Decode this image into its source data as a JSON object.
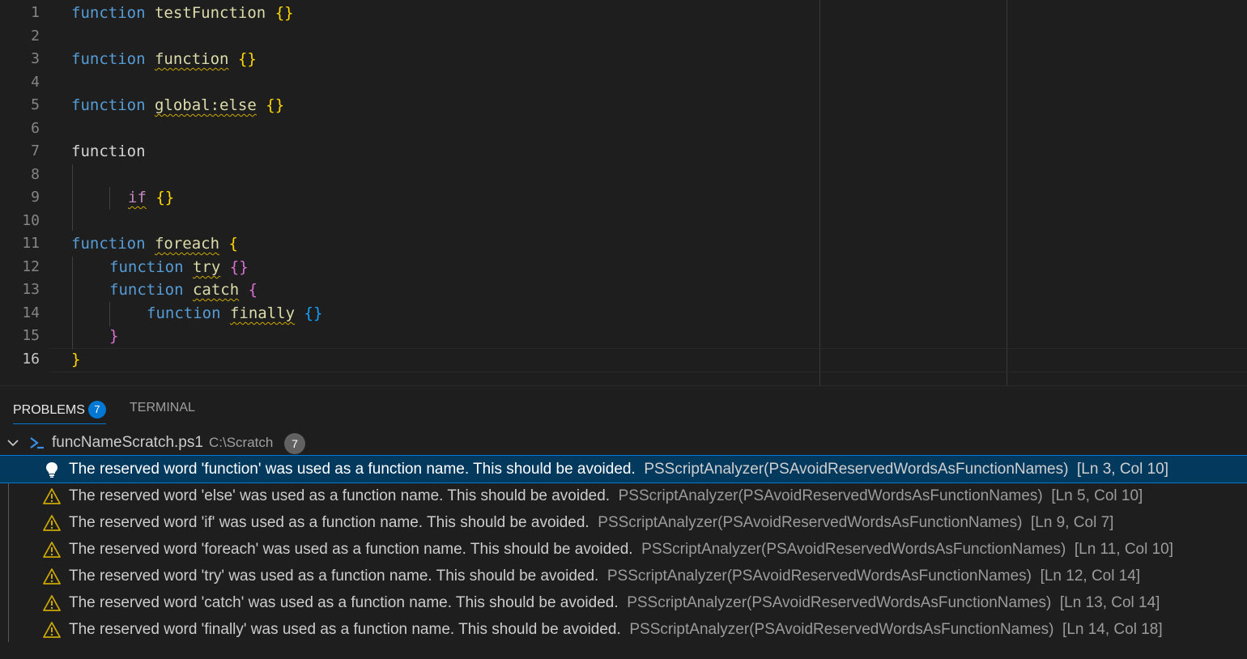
{
  "editor": {
    "line_numbers": [
      "1",
      "2",
      "3",
      "4",
      "5",
      "6",
      "7",
      "8",
      "9",
      "10",
      "11",
      "12",
      "13",
      "14",
      "15",
      "16"
    ],
    "active_line": "16",
    "tokens": {
      "function_kw": "function",
      "test_name": "testFunction",
      "function_name": "function",
      "global_name": "global:else",
      "if_name": "if",
      "foreach_name": "foreach",
      "try_name": "try",
      "catch_name": "catch",
      "finally_name": "finally",
      "empty_braces": "{}",
      "open_brace": "{",
      "close_brace": "}"
    }
  },
  "panel": {
    "tabs": {
      "problems": "PROBLEMS",
      "problems_count": "7",
      "terminal": "TERMINAL"
    },
    "file": {
      "name": "funcNameScratch.ps1",
      "path": "C:\\Scratch",
      "count": "7"
    },
    "problems": [
      {
        "message": "The reserved word 'function' was used as a function name. This should be avoided.",
        "source": "PSScriptAnalyzer(PSAvoidReservedWordsAsFunctionNames)",
        "location": "[Ln 3, Col 10]",
        "icon": "lightbulb-icon"
      },
      {
        "message": "The reserved word 'else' was used as a function name. This should be avoided.",
        "source": "PSScriptAnalyzer(PSAvoidReservedWordsAsFunctionNames)",
        "location": "[Ln 5, Col 10]",
        "icon": "warning-icon"
      },
      {
        "message": "The reserved word 'if' was used as a function name. This should be avoided.",
        "source": "PSScriptAnalyzer(PSAvoidReservedWordsAsFunctionNames)",
        "location": "[Ln 9, Col 7]",
        "icon": "warning-icon"
      },
      {
        "message": "The reserved word 'foreach' was used as a function name. This should be avoided.",
        "source": "PSScriptAnalyzer(PSAvoidReservedWordsAsFunctionNames)",
        "location": "[Ln 11, Col 10]",
        "icon": "warning-icon"
      },
      {
        "message": "The reserved word 'try' was used as a function name. This should be avoided.",
        "source": "PSScriptAnalyzer(PSAvoidReservedWordsAsFunctionNames)",
        "location": "[Ln 12, Col 14]",
        "icon": "warning-icon"
      },
      {
        "message": "The reserved word 'catch' was used as a function name. This should be avoided.",
        "source": "PSScriptAnalyzer(PSAvoidReservedWordsAsFunctionNames)",
        "location": "[Ln 13, Col 14]",
        "icon": "warning-icon"
      },
      {
        "message": "The reserved word 'finally' was used as a function name. This should be avoided.",
        "source": "PSScriptAnalyzer(PSAvoidReservedWordsAsFunctionNames)",
        "location": "[Ln 14, Col 18]",
        "icon": "warning-icon"
      }
    ]
  },
  "colors": {
    "background": "#1e1e1e",
    "keyword": "#569cd6",
    "function_name": "#dcdcaa",
    "bracket_level1": "#ffd700",
    "bracket_level2": "#da70d6",
    "bracket_level3": "#179fff",
    "warning": "#cca700",
    "selection": "#04395e",
    "accent": "#0078d4"
  }
}
